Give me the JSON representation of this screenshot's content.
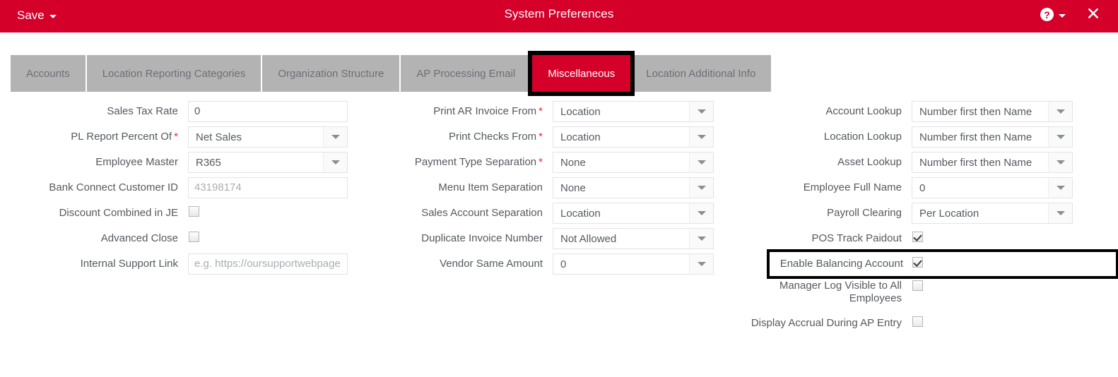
{
  "header": {
    "save_label": "Save",
    "title": "System Preferences",
    "help_glyph": "?",
    "close_glyph": "✕"
  },
  "tabs": [
    {
      "label": "Accounts",
      "active": false
    },
    {
      "label": "Location Reporting Categories",
      "active": false
    },
    {
      "label": "Organization Structure",
      "active": false
    },
    {
      "label": "AP Processing Email",
      "active": false
    },
    {
      "label": "Miscellaneous",
      "active": true,
      "annotated": true
    },
    {
      "label": "Location Additional Info",
      "active": false
    }
  ],
  "colors": {
    "brand_red": "#D4002A",
    "tab_gray": "#b3b3b3",
    "label_gray": "#55595f",
    "required_red": "#e8273f",
    "annotation_black": "#000000"
  },
  "columns": {
    "col1": [
      {
        "label": "Sales Tax Rate",
        "required": false,
        "type": "text",
        "value": "0",
        "placeholder": ""
      },
      {
        "label": "PL Report Percent Of",
        "required": true,
        "type": "select",
        "value": "Net Sales"
      },
      {
        "label": "Employee Master",
        "required": false,
        "type": "select",
        "value": "R365"
      },
      {
        "label": "Bank Connect Customer ID",
        "required": false,
        "type": "text",
        "value": "",
        "placeholder": "43198174"
      },
      {
        "label": "Discount Combined in JE",
        "required": false,
        "type": "checkbox",
        "checked": false
      },
      {
        "label": "Advanced Close",
        "required": false,
        "type": "checkbox",
        "checked": false
      },
      {
        "label": "Internal Support Link",
        "required": false,
        "type": "text",
        "value": "",
        "placeholder": "e.g. https://oursupportwebpage"
      }
    ],
    "col2": [
      {
        "label": "Print AR Invoice From",
        "required": true,
        "type": "select",
        "value": "Location"
      },
      {
        "label": "Print Checks From",
        "required": true,
        "type": "select",
        "value": "Location"
      },
      {
        "label": "Payment Type Separation",
        "required": true,
        "type": "select",
        "value": "None"
      },
      {
        "label": "Menu Item Separation",
        "required": false,
        "type": "select",
        "value": "None"
      },
      {
        "label": "Sales Account Separation",
        "required": false,
        "type": "select",
        "value": "Location"
      },
      {
        "label": "Duplicate Invoice Number",
        "required": false,
        "type": "select",
        "value": "Not Allowed"
      },
      {
        "label": "Vendor Same Amount",
        "required": false,
        "type": "select",
        "value": "0"
      }
    ],
    "col3": [
      {
        "label": "Account Lookup",
        "required": false,
        "type": "select",
        "value": "Number first then Name"
      },
      {
        "label": "Location Lookup",
        "required": false,
        "type": "select",
        "value": "Number first then Name"
      },
      {
        "label": "Asset Lookup",
        "required": false,
        "type": "select",
        "value": "Number first then Name"
      },
      {
        "label": "Employee Full Name",
        "required": false,
        "type": "select",
        "value": "0"
      },
      {
        "label": "Payroll Clearing",
        "required": false,
        "type": "select",
        "value": "Per Location"
      },
      {
        "label": "POS Track Paidout",
        "required": false,
        "type": "checkbox",
        "checked": true
      },
      {
        "label": "Enable Balancing Account",
        "required": false,
        "type": "checkbox",
        "checked": true,
        "annotated": true
      },
      {
        "label": "Manager Log Visible to All Employees",
        "required": false,
        "type": "checkbox",
        "checked": false,
        "tall": true
      },
      {
        "label": "Display Accrual During AP Entry",
        "required": false,
        "type": "checkbox",
        "checked": false
      }
    ]
  }
}
